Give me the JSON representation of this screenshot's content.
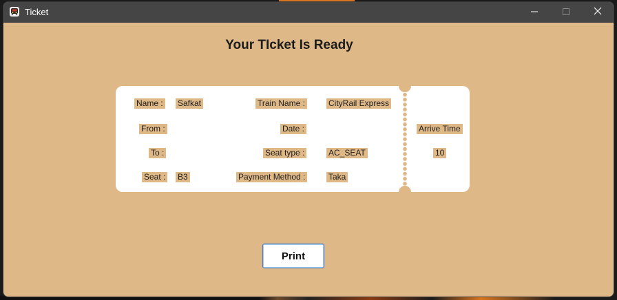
{
  "window": {
    "title": "Ticket",
    "controls": {
      "minimize": "minimize-icon",
      "maximize": "maximize-icon",
      "close": "close-icon"
    }
  },
  "heading": "Your TIcket Is Ready",
  "ticket": {
    "name_label": "Name :",
    "name_value": "Safkat",
    "from_label": "From :",
    "from_value": "",
    "to_label": "To :",
    "to_value": "",
    "seat_label": "Seat :",
    "seat_value": "B3",
    "train_name_label": "Train Name :",
    "train_name_value": "CityRail Express",
    "date_label": "Date :",
    "date_value": "",
    "seat_type_label": "Seat type :",
    "seat_type_value": "AC_SEAT",
    "payment_method_label": "Payment Method :",
    "payment_method_value": "Taka",
    "arrive_time_label": "Arrive Time",
    "arrive_time_value": "10"
  },
  "print_button": "Print",
  "colors": {
    "background": "#deb887",
    "titlebar": "#454545",
    "ticket_card": "#ffffff",
    "button_border": "#3a7bd5"
  }
}
